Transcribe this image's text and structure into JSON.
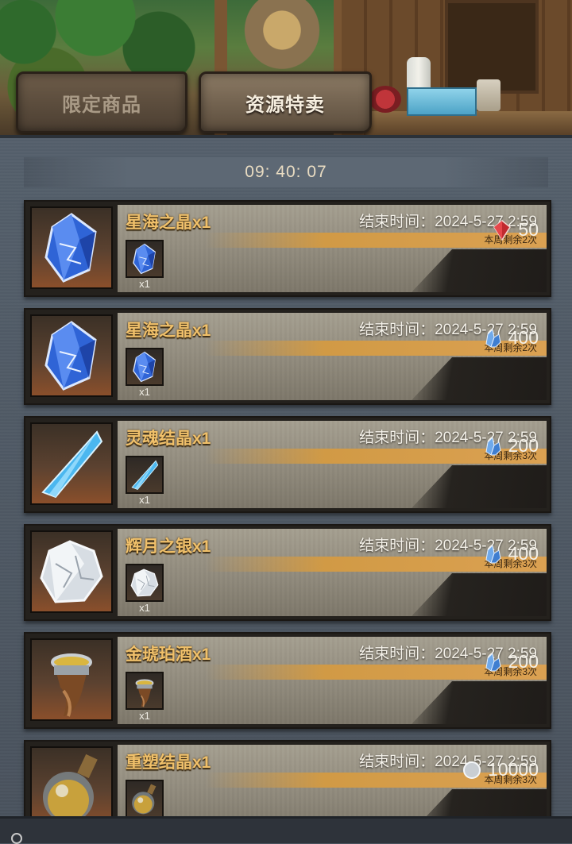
{
  "tabs": [
    {
      "label": "限定商品",
      "active": false
    },
    {
      "label": "资源特卖",
      "active": true
    }
  ],
  "timer": "09: 40: 07",
  "items": [
    {
      "name": "星海之晶x1",
      "end_time": "结束时间：2024-5-27 2:59",
      "weekly": "本周剩余2次",
      "qty": "x1",
      "price": "50",
      "icon": "starsea-crystal-icon",
      "currency": "red-gem-icon"
    },
    {
      "name": "星海之晶x1",
      "end_time": "结束时间：2024-5-27 2:59",
      "weekly": "本周剩余2次",
      "qty": "x1",
      "price": "400",
      "icon": "starsea-crystal-icon",
      "currency": "blue-crystal-icon"
    },
    {
      "name": "灵魂结晶x1",
      "end_time": "结束时间：2024-5-27 2:59",
      "weekly": "本周剩余3次",
      "qty": "x1",
      "price": "200",
      "icon": "soul-crystal-icon",
      "currency": "blue-crystal-icon"
    },
    {
      "name": "辉月之银x1",
      "end_time": "结束时间：2024-5-27 2:59",
      "weekly": "本周剩余3次",
      "qty": "x1",
      "price": "400",
      "icon": "moon-silver-icon",
      "currency": "blue-crystal-icon"
    },
    {
      "name": "金琥珀酒x1",
      "end_time": "结束时间：2024-5-27 2:59",
      "weekly": "本周剩余3次",
      "qty": "x1",
      "price": "200",
      "icon": "amber-ale-horn-icon",
      "currency": "blue-crystal-icon"
    },
    {
      "name": "重塑结晶x1",
      "end_time": "结束时间：2024-5-27 2:59",
      "weekly": "本周剩余3次",
      "qty": "",
      "price": "10000",
      "icon": "reshape-crystal-icon",
      "currency": "silver-coin-icon"
    }
  ],
  "colors": {
    "item_name": "#f0c06a",
    "weekly_bar": "#d19a45",
    "panel_bg": "#4c5560"
  }
}
